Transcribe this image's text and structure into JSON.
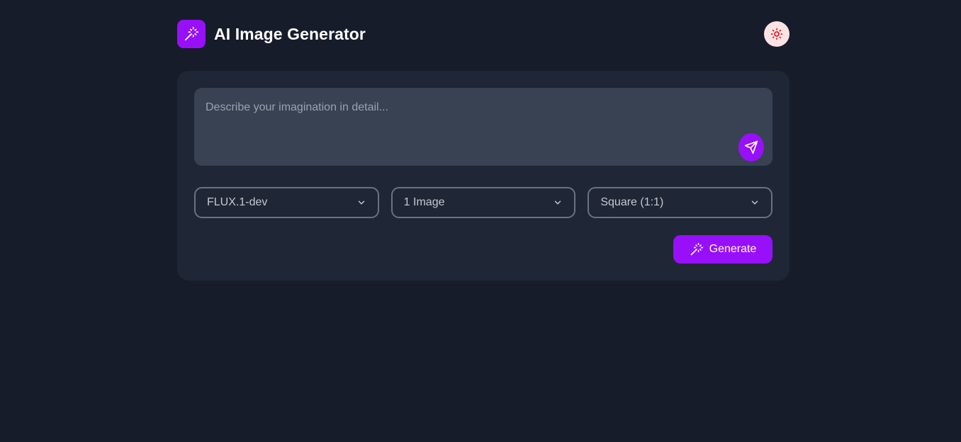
{
  "app": {
    "title": "AI Image Generator",
    "logo_icon": "magic-wand-icon",
    "theme_toggle_icon": "sun-icon"
  },
  "prompt": {
    "value": "",
    "placeholder": "Describe your imagination in detail...",
    "send_icon": "send-icon"
  },
  "selects": {
    "model": {
      "value": "FLUX.1-dev",
      "icon": "chevron-down-icon"
    },
    "count": {
      "value": "1 Image",
      "icon": "chevron-down-icon"
    },
    "ratio": {
      "value": "Square (1:1)",
      "icon": "chevron-down-icon"
    }
  },
  "generate": {
    "label": "Generate",
    "icon": "magic-wand-icon"
  },
  "colors": {
    "background": "#171c2b",
    "card": "#1f2736",
    "input": "#384252",
    "accent": "#9810fa",
    "toggle_bg": "#fde4e4",
    "toggle_icon": "#e7000b"
  }
}
